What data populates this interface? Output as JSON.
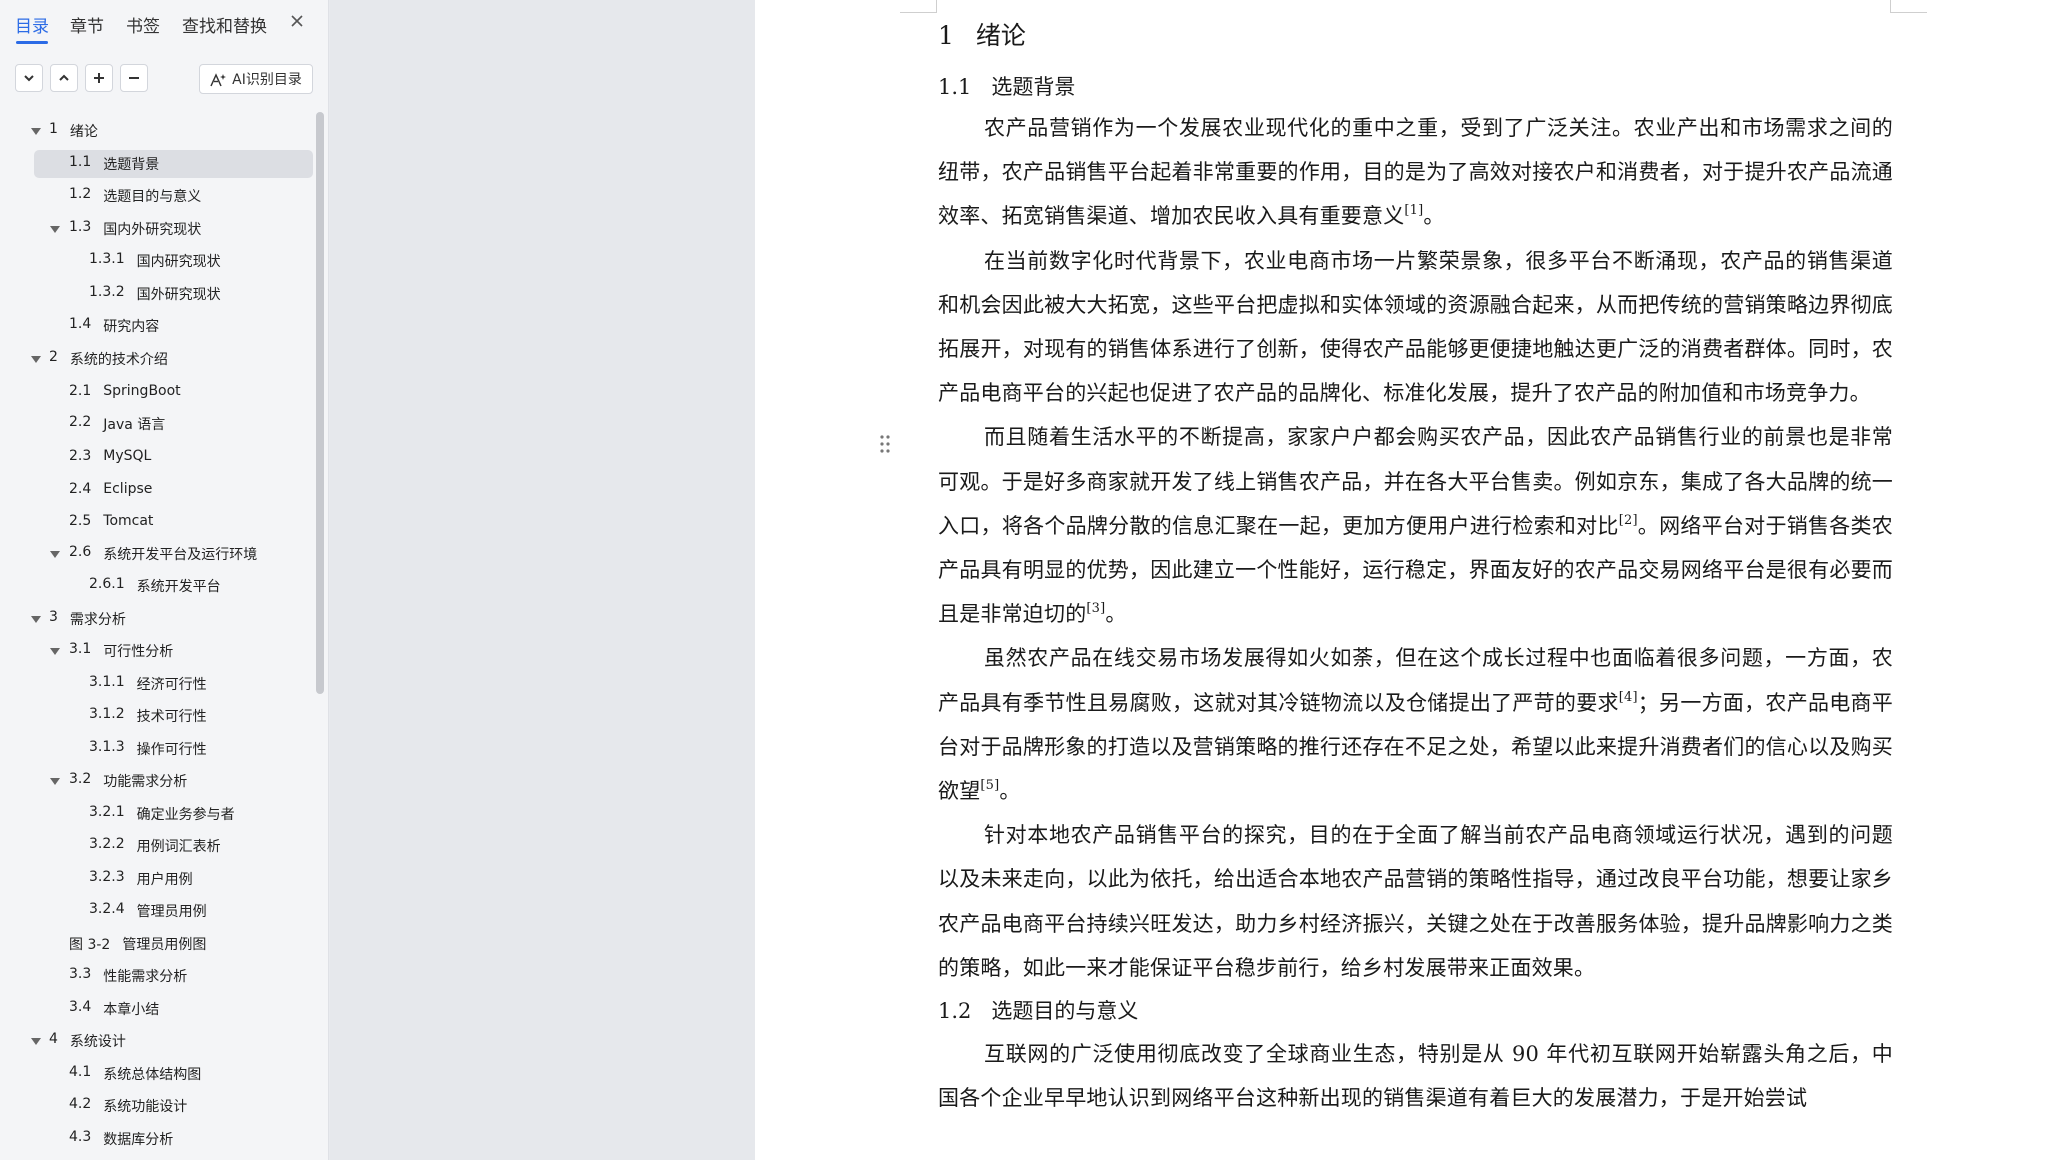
{
  "sidebar": {
    "tabs": [
      {
        "label": "目录",
        "active": true
      },
      {
        "label": "章节"
      },
      {
        "label": "书签"
      },
      {
        "label": "查找和替换"
      }
    ],
    "close_icon": "close-icon",
    "toolbar": {
      "expand_icon": "chevron-down-icon",
      "collapse_icon": "chevron-up-icon",
      "add_icon": "plus-icon",
      "remove_icon": "minus-icon",
      "ai_label": "AI识别目录"
    },
    "toc": [
      {
        "num": "1",
        "title": "绪论",
        "level": 1,
        "caret": true
      },
      {
        "num": "1.1",
        "title": "选题背景",
        "level": 2,
        "selected": true
      },
      {
        "num": "1.2",
        "title": "选题目的与意义",
        "level": 2
      },
      {
        "num": "1.3",
        "title": "国内外研究现状",
        "level": 2,
        "caret": true
      },
      {
        "num": "1.3.1",
        "title": "国内研究现状",
        "level": 3
      },
      {
        "num": "1.3.2",
        "title": "国外研究现状",
        "level": 3
      },
      {
        "num": "1.4",
        "title": "研究内容",
        "level": 2
      },
      {
        "num": "2",
        "title": "系统的技术介绍",
        "level": 1,
        "caret": true
      },
      {
        "num": "2.1",
        "title": "SpringBoot",
        "level": 2
      },
      {
        "num": "2.2",
        "title": "Java 语言",
        "level": 2
      },
      {
        "num": "2.3",
        "title": "MySQL",
        "level": 2
      },
      {
        "num": "2.4",
        "title": "Eclipse",
        "level": 2
      },
      {
        "num": "2.5",
        "title": "Tomcat",
        "level": 2
      },
      {
        "num": "2.6",
        "title": "系统开发平台及运行环境",
        "level": 2,
        "caret": true
      },
      {
        "num": "2.6.1",
        "title": "系统开发平台",
        "level": 3
      },
      {
        "num": "3",
        "title": "需求分析",
        "level": 1,
        "caret": true
      },
      {
        "num": "3.1",
        "title": "可行性分析",
        "level": 2,
        "caret": true
      },
      {
        "num": "3.1.1",
        "title": "经济可行性",
        "level": 3
      },
      {
        "num": "3.1.2",
        "title": "技术可行性",
        "level": 3
      },
      {
        "num": "3.1.3",
        "title": "操作可行性",
        "level": 3
      },
      {
        "num": "3.2",
        "title": "功能需求分析",
        "level": 2,
        "caret": true
      },
      {
        "num": "3.2.1",
        "title": "确定业务参与者",
        "level": 3
      },
      {
        "num": "3.2.2",
        "title": "用例词汇表析",
        "level": 3
      },
      {
        "num": "3.2.3",
        "title": "用户用例",
        "level": 3
      },
      {
        "num": "3.2.4",
        "title": "管理员用例",
        "level": 3
      },
      {
        "num": "图 3-2",
        "title": "管理员用例图",
        "level": 2
      },
      {
        "num": "3.3",
        "title": "性能需求分析",
        "level": 2
      },
      {
        "num": "3.4",
        "title": "本章小结",
        "level": 2
      },
      {
        "num": "4",
        "title": "系统设计",
        "level": 1,
        "caret": true
      },
      {
        "num": "4.1",
        "title": "系统总体结构图",
        "level": 2
      },
      {
        "num": "4.2",
        "title": "系统功能设计",
        "level": 2
      },
      {
        "num": "4.3",
        "title": "数据库分析",
        "level": 2
      }
    ]
  },
  "document": {
    "h1": {
      "num": "1",
      "title": "绪论"
    },
    "s1": {
      "num": "1.1",
      "title": "选题背景"
    },
    "p1": {
      "text": "农产品营销作为一个发展农业现代化的重中之重，受到了广泛关注。农业产出和市场需求之间的纽带，农产品销售平台起着非常重要的作用，目的是为了高效对接农户和消费者，对于提升农产品流通效率、拓宽销售渠道、增加农民收入具有重要意义",
      "ref": "[1]",
      "tail": "。"
    },
    "p2": {
      "text": "在当前数字化时代背景下，农业电商市场一片繁荣景象，很多平台不断涌现，农产品的销售渠道和机会因此被大大拓宽，这些平台把虚拟和实体领域的资源融合起来，从而把传统的营销策略边界彻底拓展开，对现有的销售体系进行了创新，使得农产品能够更便捷地触达更广泛的消费者群体。同时，农产品电商平台的兴起也促进了农产品的品牌化、标准化发展，提升了农产品的附加值和市场竞争力。"
    },
    "p3": {
      "a": "而且随着生活水平的不断提高，家家户户都会购买农产品，因此农产品销售行业的前景也是非常可观。于是好多商家就开发了线上销售农产品，并在各大平台售卖。例如京东，集成了各大品牌的统一入口，将各个品牌分散的信息汇聚在一起，更加方便用户进行检索和对比",
      "ref1": "[2]",
      "b": "。网络平台对于销售各类农产品具有明显的优势，因此建立一个性能好，运行稳定，界面友好的农产品交易网络平台是很有必要而且是非常迫切的",
      "ref2": "[3]",
      "c": "。"
    },
    "p4": {
      "a": "虽然农产品在线交易市场发展得如火如荼，但在这个成长过程中也面临着很多问题，一方面，农产品具有季节性且易腐败，这就对其冷链物流以及仓储提出了严苛的要求",
      "ref1": "[4]",
      "b": "；另一方面，农产品电商平台对于品牌形象的打造以及营销策略的推行还存在不足之处，希望以此来提升消费者们的信心以及购买欲望",
      "ref2": "[5]",
      "c": "。"
    },
    "p5": {
      "text": "针对本地农产品销售平台的探究，目的在于全面了解当前农产品电商领域运行状况，遇到的问题以及未来走向，以此为依托，给出适合本地农产品营销的策略性指导，通过改良平台功能，想要让家乡农产品电商平台持续兴旺发达，助力乡村经济振兴，关键之处在于改善服务体验，提升品牌影响力之类的策略，如此一来才能保证平台稳步前行，给乡村发展带来正面效果。"
    },
    "s2": {
      "num": "1.2",
      "title": "选题目的与意义"
    },
    "p6": {
      "text": "互联网的广泛使用彻底改变了全球商业生态，特别是从 90 年代初互联网开始崭露头角之后，中国各个企业早早地认识到网络平台这种新出现的销售渠道有着巨大的发展潜力，于是开始尝试"
    }
  }
}
